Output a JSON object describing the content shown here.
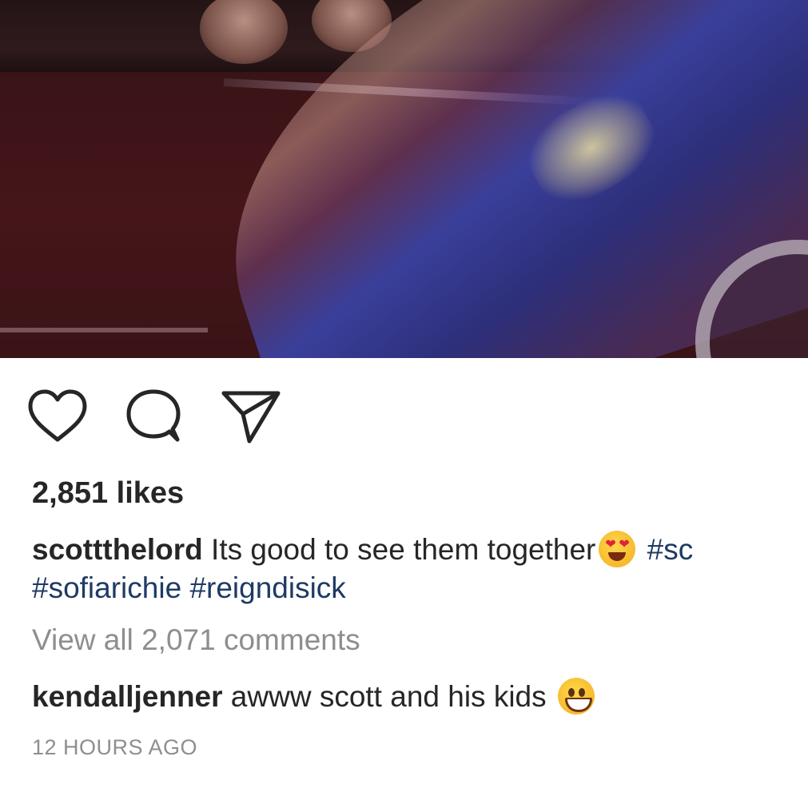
{
  "post": {
    "likes_text": "2,851 likes",
    "caption": {
      "username": "scottthelord",
      "text": " Its good to see them together",
      "emoji": "heart-eyes-emoji",
      "hashtag_1": "#sc",
      "hashtag_2": "#sofiarichie",
      "hashtag_3": "#reigndisick"
    },
    "view_all_comments": "View all 2,071 comments",
    "top_comment": {
      "username": "kendalljenner",
      "text": " awww scott and his kids ",
      "emoji": "grinning-face-emoji"
    },
    "timestamp": "12 HOURS AGO"
  },
  "actions": {
    "like_icon": "heart-icon",
    "comment_icon": "speech-bubble-icon",
    "share_icon": "paper-plane-icon"
  },
  "colors": {
    "text": "#262626",
    "muted": "#8e8e8e",
    "hashtag": "#1f3a63"
  }
}
